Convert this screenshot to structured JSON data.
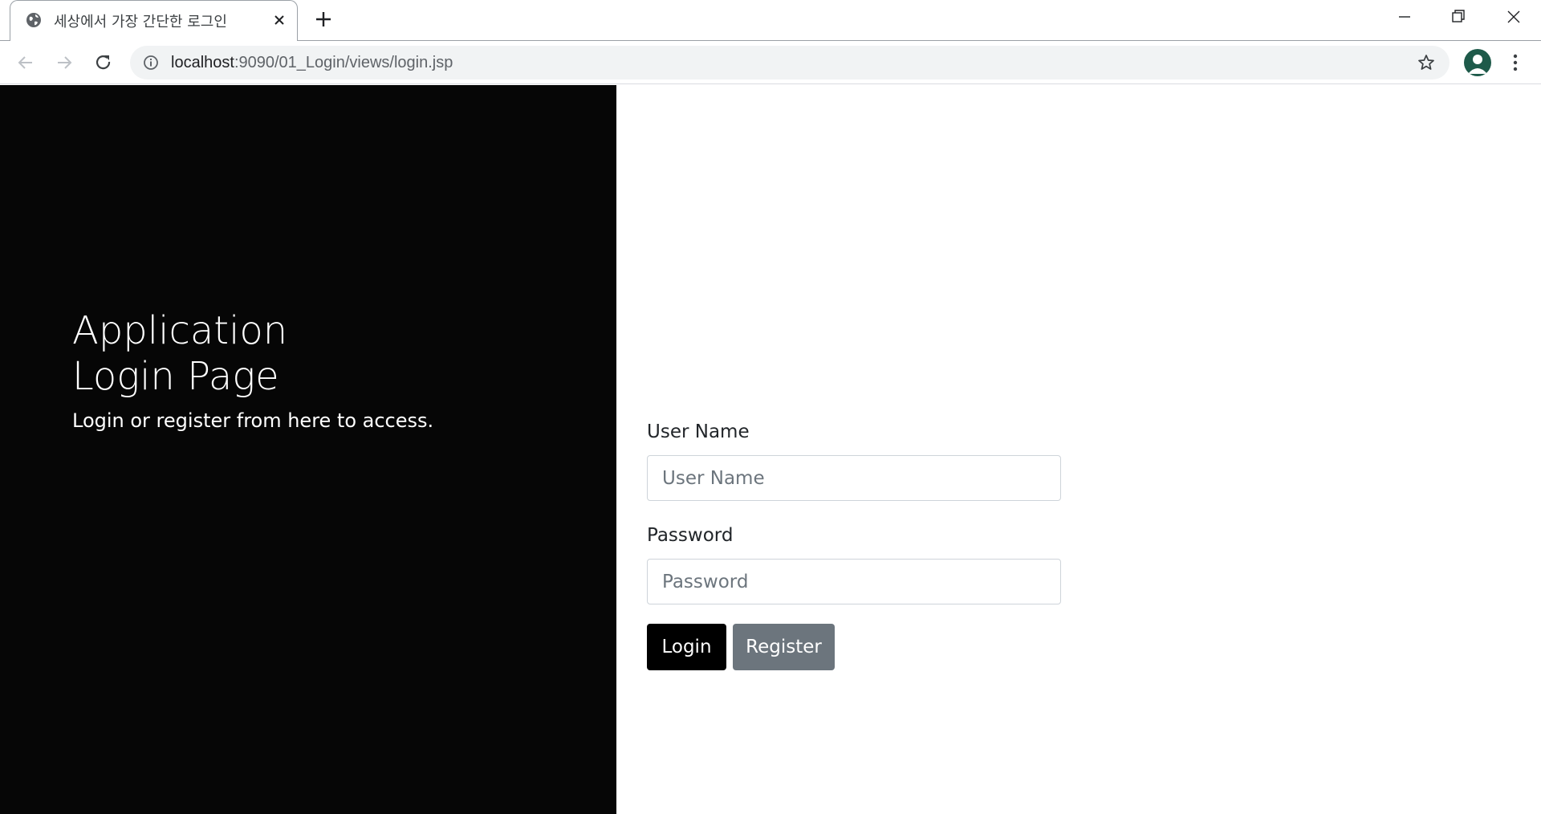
{
  "browser": {
    "tab_title": "세상에서 가장 간단한 로그인",
    "url_host": "localhost",
    "url_rest": ":9090/01_Login/views/login.jsp"
  },
  "icons": {
    "favicon": "globe-icon",
    "tab_close": "close-icon",
    "new_tab": "plus-icon",
    "back": "arrow-left-icon",
    "forward": "arrow-right-icon",
    "reload": "reload-icon",
    "site_info": "info-icon",
    "bookmark": "star-icon",
    "profile": "avatar-icon",
    "menu": "more-vertical-icon"
  },
  "sidenav": {
    "title_line1": "Application",
    "title_line2": "Login Page",
    "subtitle": "Login or register from here to access."
  },
  "form": {
    "username_label": "User Name",
    "username_placeholder": "User Name",
    "password_label": "Password",
    "password_placeholder": "Password",
    "login_button": "Login",
    "register_button": "Register"
  },
  "colors": {
    "sidenav_bg": "#060606",
    "login_button_bg": "#000000",
    "register_button_bg": "#6c757d"
  }
}
